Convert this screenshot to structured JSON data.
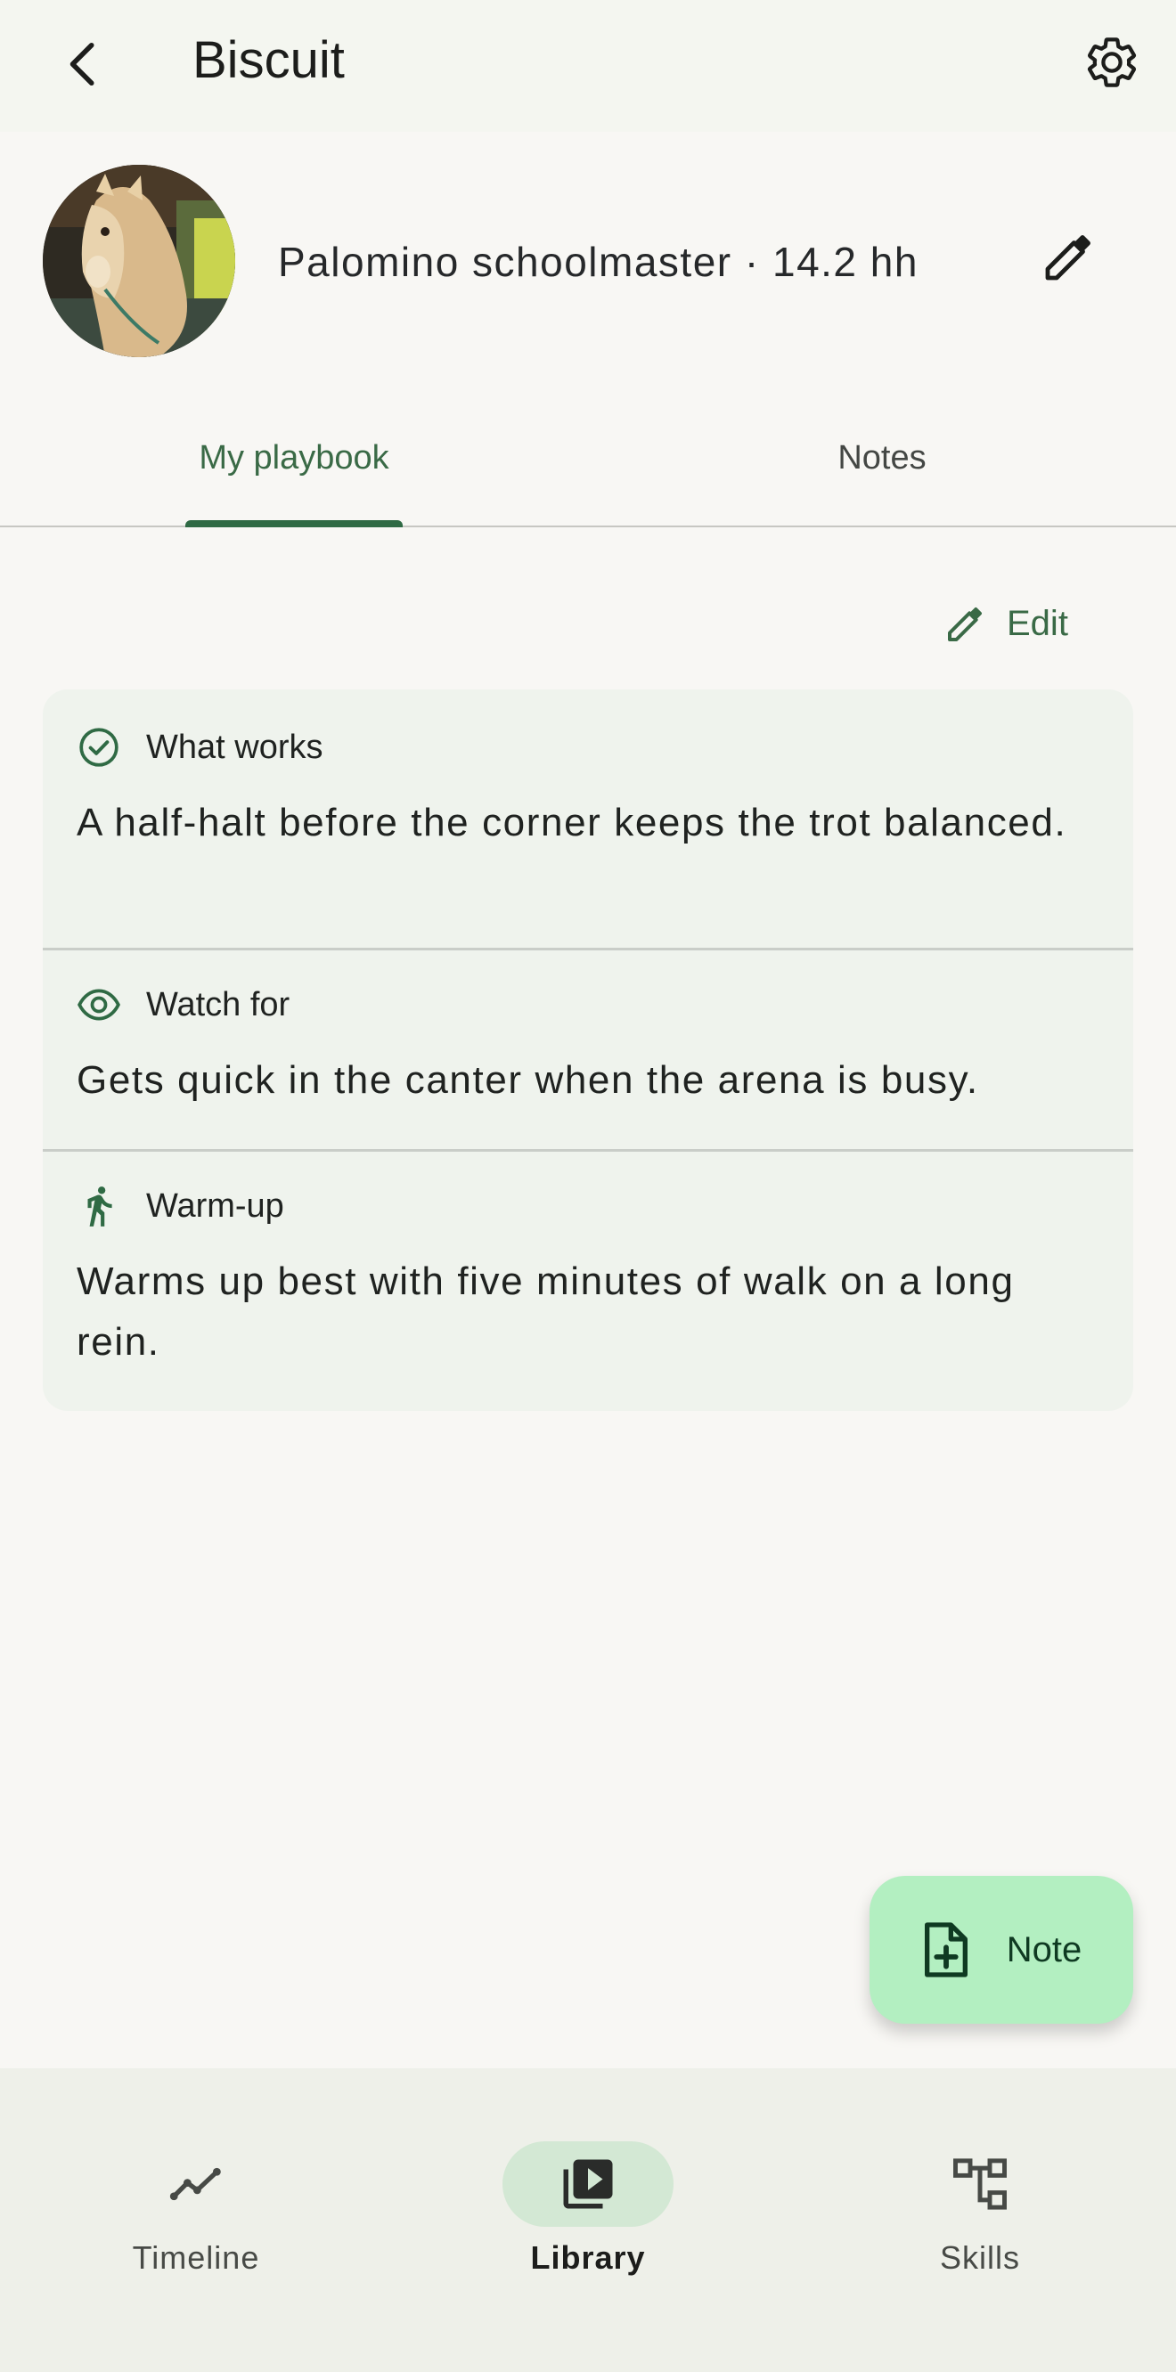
{
  "header": {
    "title": "Biscuit",
    "back_icon": "arrow-back-icon",
    "settings_icon": "gear-icon"
  },
  "profile": {
    "subtitle": "Palomino schoolmaster · 14.2 hh",
    "edit_icon": "pencil-icon",
    "avatar": "horse-photo"
  },
  "tabs": [
    {
      "label": "My playbook",
      "selected": true
    },
    {
      "label": "Notes",
      "selected": false
    }
  ],
  "playbook": {
    "edit_label": "Edit",
    "sections": [
      {
        "icon": "check-circle-icon",
        "title": "What works",
        "body": "A half-halt before the corner keeps the trot balanced."
      },
      {
        "icon": "eye-icon",
        "title": "Watch for",
        "body": "Gets quick in the canter when the arena is busy."
      },
      {
        "icon": "walking-person-icon",
        "title": "Warm-up",
        "body": "Warms up best with five minutes of walk on a long rein."
      }
    ]
  },
  "fab": {
    "label": "Note",
    "icon": "note-add-icon"
  },
  "bottom_nav": [
    {
      "label": "Timeline",
      "icon": "trend-line-icon",
      "selected": false
    },
    {
      "label": "Library",
      "icon": "video-library-icon",
      "selected": true
    },
    {
      "label": "Skills",
      "icon": "hierarchy-icon",
      "selected": false
    }
  ],
  "colors": {
    "accent": "#2f6a44",
    "fab": "#b3efc1",
    "card": "#eff3ed",
    "nav_active": "#d3e8d4"
  }
}
